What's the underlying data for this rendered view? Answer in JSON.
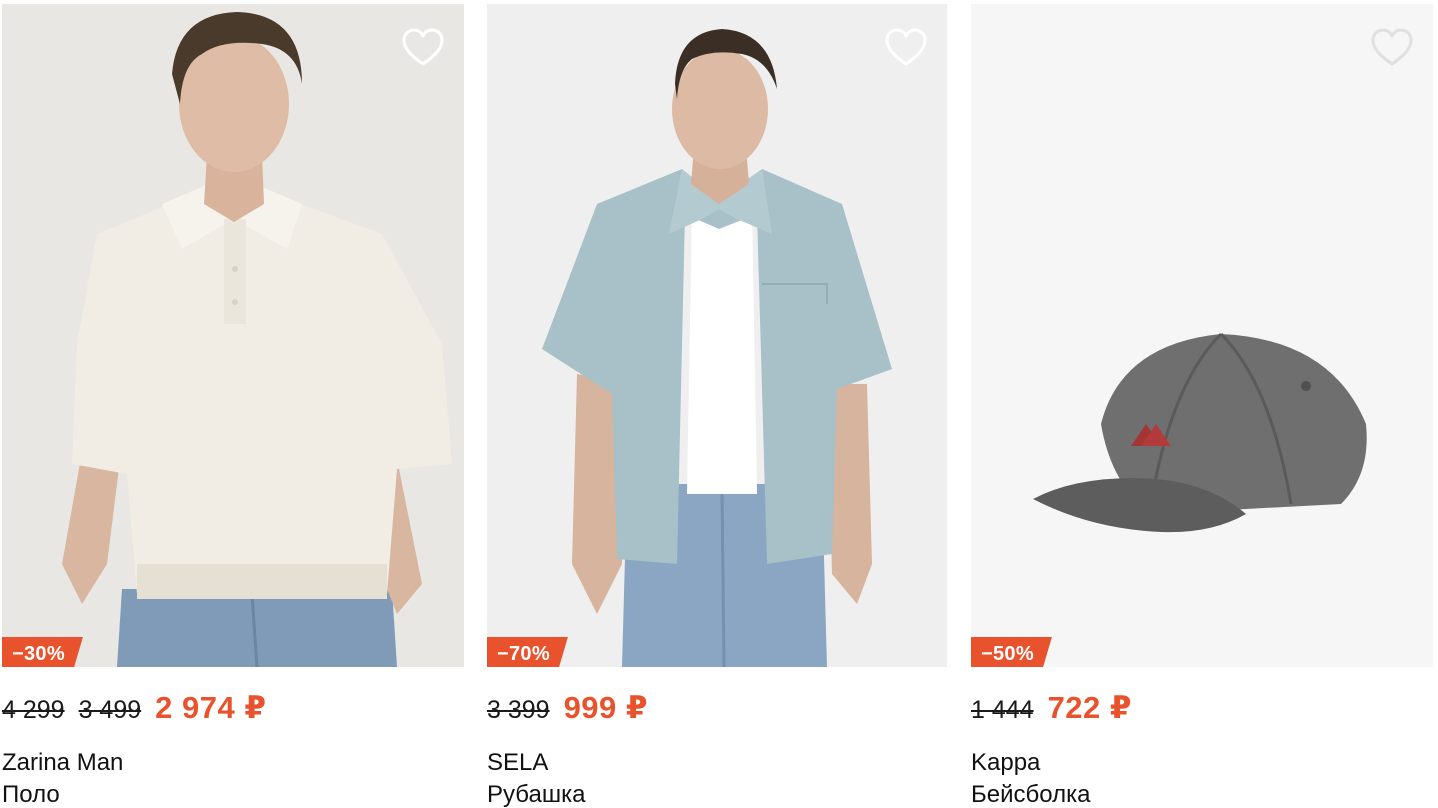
{
  "colors": {
    "accent": "#e8522d",
    "text": "#111111",
    "photo_bg": "#efefef"
  },
  "products": [
    {
      "discount": "−30%",
      "old_prices": [
        "4 299",
        "3 499"
      ],
      "price": "2 974 ₽",
      "brand": "Zarina Man",
      "type": "Поло",
      "icon": "heart-outline-icon"
    },
    {
      "discount": "−70%",
      "old_prices": [
        "3 399"
      ],
      "price": "999 ₽",
      "brand": "SELA",
      "type": "Рубашка",
      "icon": "heart-outline-icon"
    },
    {
      "discount": "−50%",
      "old_prices": [
        "1 444"
      ],
      "price": "722 ₽",
      "brand": "Kappa",
      "type": "Бейсболка",
      "icon": "heart-outline-icon"
    }
  ]
}
